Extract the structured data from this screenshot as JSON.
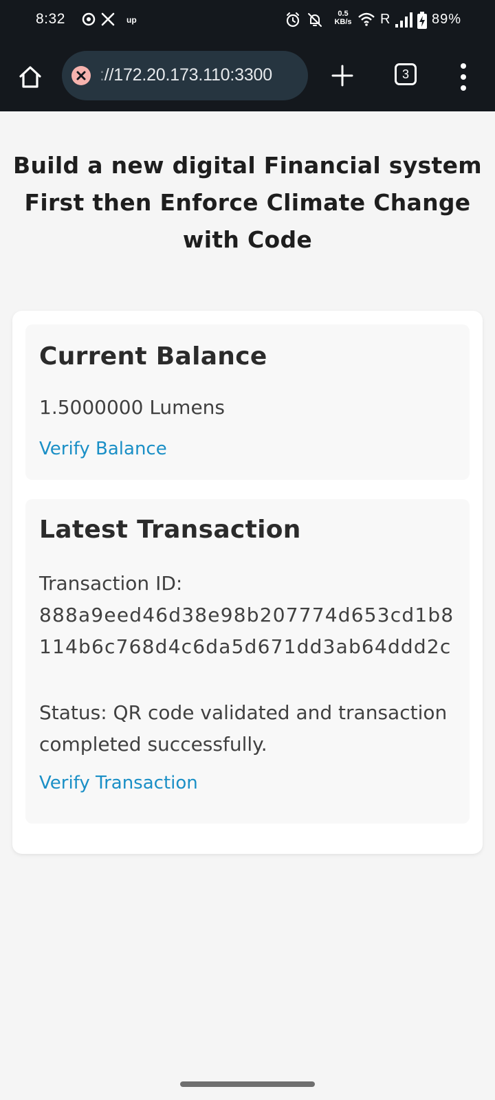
{
  "status_bar": {
    "time": "8:32",
    "network_speed_value": "0.5",
    "network_speed_unit": "KB/s",
    "carrier_indicator": "R",
    "battery_percent": "89%",
    "up_label": "up",
    "icons": [
      "threads-icon",
      "x-icon",
      "alarm-icon",
      "mute-icon",
      "wifi-icon",
      "signal-icon",
      "battery-charging-icon"
    ]
  },
  "browser": {
    "url_prefix": ":",
    "url": "//172.20.173.110:3300",
    "tab_count": "3",
    "icons": [
      "home-icon",
      "insecure-icon",
      "plus-icon",
      "tab-switcher-icon",
      "more-menu-icon"
    ]
  },
  "page": {
    "title": "Build a new digital Financial system First then Enforce Climate Change with Code",
    "balance": {
      "heading": "Current Balance",
      "amount": "1.5000000 Lumens",
      "link": "Verify Balance"
    },
    "transaction": {
      "heading": "Latest Transaction",
      "id_label": "Transaction ID:",
      "id_value": "888a9eed46d38e98b207774d653cd1b8114b6c768d4c6da5d671dd3ab64ddd2c",
      "status": "Status: QR code validated and transaction completed successfully.",
      "link": "Verify Transaction"
    }
  },
  "colors": {
    "chrome_background": "#14181d",
    "url_pill": "#263540",
    "insecure_badge": "#f6b3ae",
    "link": "#1a8fc6",
    "page_background": "#f5f5f5",
    "card_background": "#ffffff",
    "section_background": "#f8f8f8"
  }
}
